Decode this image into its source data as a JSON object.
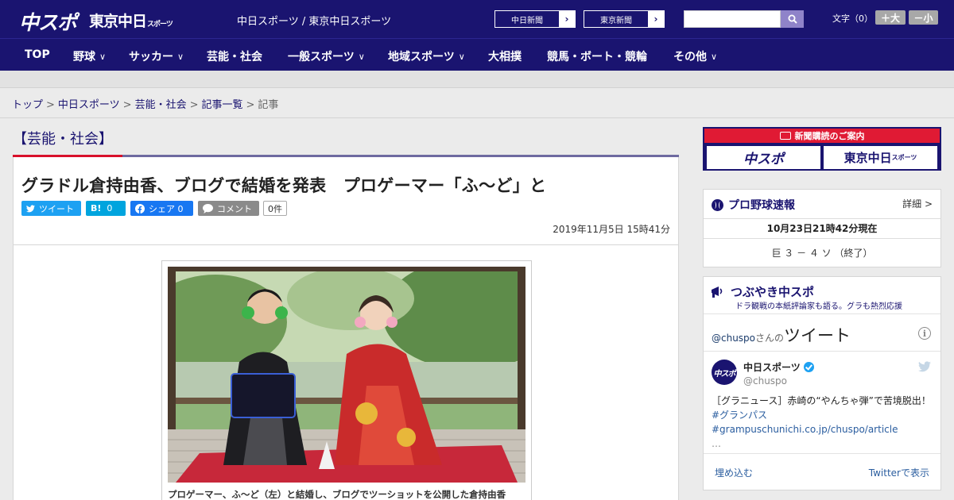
{
  "header": {
    "logo_primary": "中スポ",
    "logo_secondary": "東京中日",
    "logo_secondary_small": "スポーツ",
    "site_name": "中日スポーツ / 東京中日スポーツ",
    "paper_links": [
      {
        "label": "中日新聞"
      },
      {
        "label": "東京新聞"
      }
    ],
    "search": {
      "placeholder": ""
    },
    "font_size": {
      "label": "文字（0）",
      "increase": "＋大",
      "decrease": "－小"
    }
  },
  "nav": {
    "items": [
      {
        "label": "TOP",
        "dropdown": false
      },
      {
        "label": "野球",
        "dropdown": true
      },
      {
        "label": "サッカー",
        "dropdown": true
      },
      {
        "label": "芸能・社会",
        "dropdown": false
      },
      {
        "label": "一般スポーツ",
        "dropdown": true
      },
      {
        "label": "地域スポーツ",
        "dropdown": true
      },
      {
        "label": "大相撲",
        "dropdown": false
      },
      {
        "label": "競馬・ボート・競輪",
        "dropdown": false
      },
      {
        "label": "その他",
        "dropdown": true
      }
    ]
  },
  "breadcrumb": {
    "items": [
      "トップ",
      "中日スポーツ",
      "芸能・社会",
      "記事一覧"
    ],
    "current": "記事",
    "separator": ">"
  },
  "article": {
    "category": "【芸能・社会】",
    "title": "グラドル倉持由香、ブログで結婚を発表　プロゲーマー「ふ～ど」と",
    "share": {
      "tweet": "ツイート",
      "hatena_icon": "B!",
      "hatena_count": "0",
      "facebook": "シェア 0",
      "comment": "コメント",
      "comment_count": "0件"
    },
    "date": "2019年11月5日 15時41分",
    "photo_caption": "プロゲーマー、ふ～ど（左）と結婚し、ブログでツーショットを公開した倉持由香"
  },
  "sidebar": {
    "ad": {
      "title": "新聞購読のご案内",
      "logo_left": "中スポ",
      "logo_right": "東京中日",
      "logo_right_small": "スポーツ"
    },
    "baseball": {
      "title": "プロ野球速報",
      "detail": "詳細 >",
      "time": "10月23日21時42分現在",
      "result": "巨 ３ － ４ ソ （終了）"
    },
    "tweets": {
      "title": "つぶやき中スポ",
      "subtitle": "ドラ観戦の本紙評論家も語る。グラも熱烈応援",
      "widget_handle": "@chuspo",
      "widget_suffix": "さんの",
      "widget_label": "ツイート",
      "account_name": "中日スポーツ",
      "account_handle": "@chuspo",
      "avatar_text": "中スポ",
      "text_main": "［グラニュース］赤崎の“やんちゃ弾”で苦境脱出！",
      "text_tag": "#グランパス",
      "text_link": "#grampuschunichi.co.jp/chuspo/article",
      "text_more": "…",
      "embed": "埋め込む",
      "view": "Twitterで表示"
    }
  }
}
